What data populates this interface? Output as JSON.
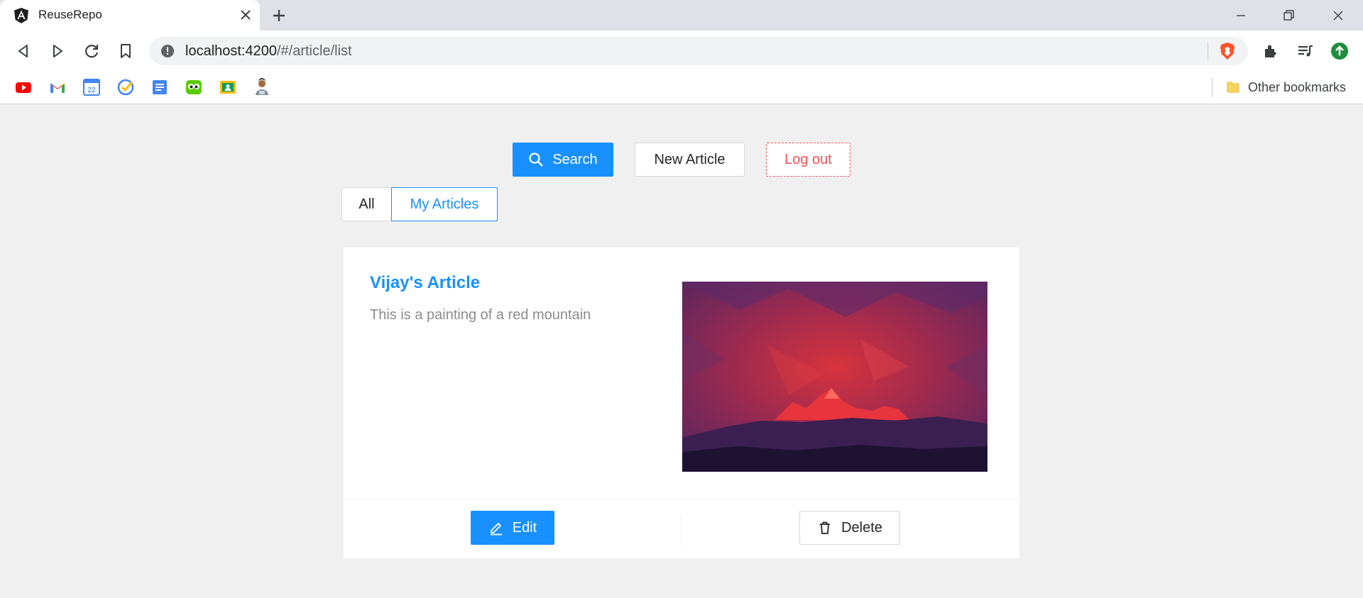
{
  "browser": {
    "tab_title": "ReuseRepo",
    "url_host": "localhost:4200",
    "url_path": "/#/article/list",
    "other_bookmarks": "Other bookmarks",
    "bookmarks": [
      "youtube",
      "gmail",
      "google-calendar",
      "tasks",
      "google-docs",
      "duolingo",
      "google-classroom",
      "avatar"
    ]
  },
  "page": {
    "search_label": "Search",
    "new_article_label": "New Article",
    "logout_label": "Log out",
    "filters": [
      "All",
      "My Articles"
    ],
    "selected_filter": "My Articles"
  },
  "articles": [
    {
      "title": "Vijay's Article",
      "description": "This is a painting of a red mountain",
      "image": "red-mountain-painting",
      "edit_label": "Edit",
      "delete_label": "Delete"
    }
  ],
  "colors": {
    "primary": "#1890ff",
    "danger": "#ff4d4f",
    "background": "#f0f0f0"
  }
}
